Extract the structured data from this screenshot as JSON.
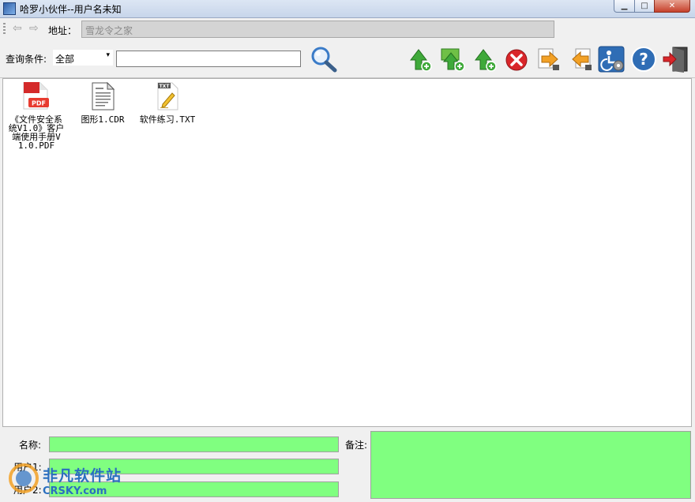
{
  "window": {
    "title": "哈罗小伙伴--用户名未知",
    "minimize_glyph": "▁",
    "maximize_glyph": "□",
    "close_glyph": "✕"
  },
  "address": {
    "back_glyph": "⇦",
    "forward_glyph": "⇨",
    "label": "地址：",
    "value": "雪龙令之家"
  },
  "query": {
    "label": "查询条件:",
    "condition_value": "全部",
    "dropdown_glyph": "▾",
    "search_value": ""
  },
  "toolbar": {
    "icons": [
      "upload-icon",
      "upload-folder-icon",
      "upload-add-icon",
      "delete-icon",
      "export-icon",
      "import-icon",
      "settings-icon",
      "help-icon",
      "exit-icon"
    ],
    "colors": {
      "green": "#3fa93a",
      "red": "#d9262a",
      "orange": "#f2a126",
      "blue": "#2f6db5"
    }
  },
  "files": [
    {
      "name": "《文件安全系统V1.0》客户端使用手册V1.0.PDF",
      "icon": "pdf-file-icon",
      "badge": "PDF"
    },
    {
      "name": "图形1.CDR",
      "icon": "document-file-icon",
      "badge": ""
    },
    {
      "name": "软件练习.TXT",
      "icon": "txt-file-icon",
      "badge": "TXT"
    }
  ],
  "details": {
    "name_label": "名称:",
    "user1_label": "用户1:",
    "user2_label": "用户2:",
    "note_label": "备注:",
    "field_color": "#80ff80"
  },
  "watermark": {
    "text": "非凡软件站",
    "url": "CRSKY.com"
  }
}
